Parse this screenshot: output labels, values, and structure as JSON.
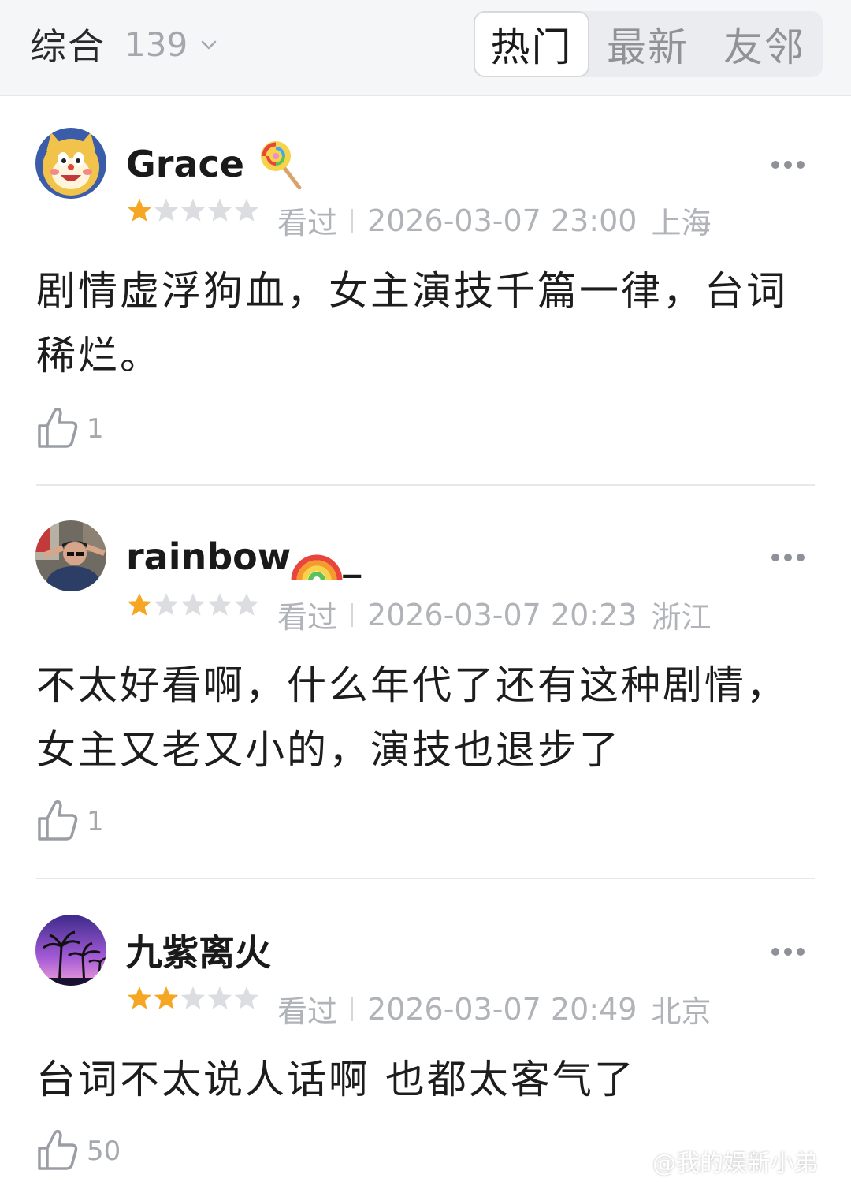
{
  "header": {
    "sort_label": "综合",
    "comment_count": "139",
    "tabs": [
      {
        "label": "热门",
        "active": true
      },
      {
        "label": "最新",
        "active": false
      },
      {
        "label": "友邻",
        "active": false
      }
    ]
  },
  "reviews": [
    {
      "username": "Grace",
      "username_icon": "lollipop-icon",
      "rating": 1,
      "max_rating": 5,
      "status": "看过",
      "datetime": "2026-03-07 23:00",
      "location": "上海",
      "content": "剧情虚浮狗血，女主演技千篇一律，台词稀烂。",
      "likes": "1"
    },
    {
      "username": "rainbow",
      "username_icon": "rainbow-icon",
      "username_suffix": "_",
      "rating": 1,
      "max_rating": 5,
      "status": "看过",
      "datetime": "2026-03-07 20:23",
      "location": "浙江",
      "content": "不太好看啊，什么年代了还有这种剧情，女主又老又小的，演技也退步了",
      "likes": "1"
    },
    {
      "username": "九紫离火",
      "rating": 2,
      "max_rating": 5,
      "status": "看过",
      "datetime": "2026-03-07 20:49",
      "location": "北京",
      "content": "台词不太说人话啊 也都太客气了",
      "likes": "50"
    }
  ],
  "watermark": "@我的娱新小弟",
  "colors": {
    "star_filled": "#f5a623",
    "star_empty": "#dcdde0",
    "meta_text": "#b0b3b8",
    "tab_bg": "#ebecef",
    "topbar_bg": "#f5f6f8"
  }
}
